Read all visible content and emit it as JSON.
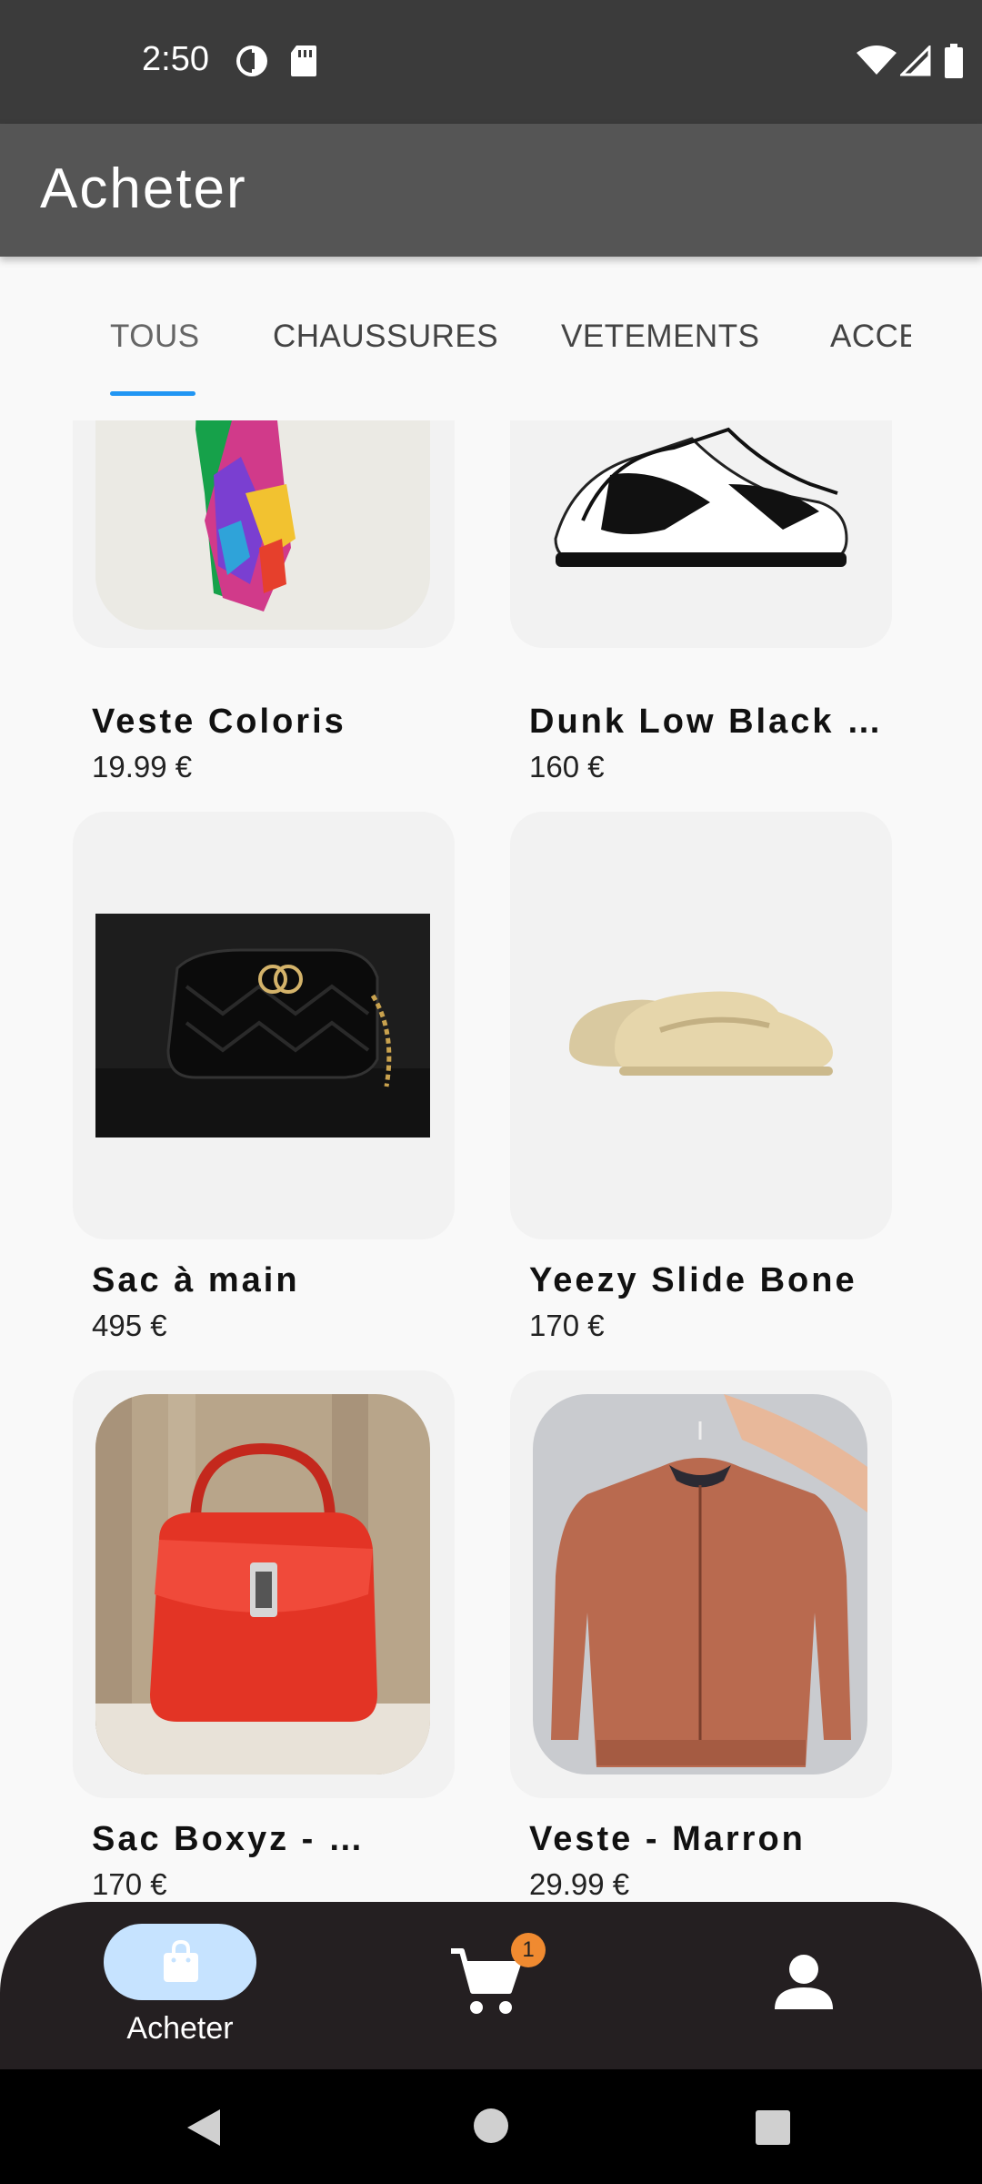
{
  "status_bar": {
    "time": "2:50",
    "icons": [
      "data-saver-icon",
      "sd-card-icon",
      "wifi-icon",
      "signal-icon",
      "battery-icon"
    ]
  },
  "app_bar": {
    "title": "Acheter"
  },
  "tabs": [
    {
      "label": "TOUS",
      "active": true
    },
    {
      "label": "CHAUSSURES",
      "active": false
    },
    {
      "label": "VETEMENTS",
      "active": false
    },
    {
      "label": "ACCE",
      "active": false
    }
  ],
  "products": [
    {
      "name": "Veste Coloris",
      "price": "19.99 €",
      "image": "scarf-photo"
    },
    {
      "name": "Dunk Low Black …",
      "price": "160 €",
      "image": "sneaker-photo"
    },
    {
      "name": "Sac à main",
      "price": "495 €",
      "image": "black-handbag-photo"
    },
    {
      "name": "Yeezy Slide Bone",
      "price": "170 €",
      "image": "slide-sandal-photo"
    },
    {
      "name": "Sac Boxyz - …",
      "price": "170 €",
      "image": "red-handbag-photo"
    },
    {
      "name": "Veste - Marron",
      "price": "29.99 €",
      "image": "brown-jacket-photo"
    }
  ],
  "bottom_nav": {
    "items": [
      {
        "label": "Acheter",
        "icon": "shopping-bag-icon",
        "active": true
      },
      {
        "label": "",
        "icon": "cart-icon",
        "badge": "1"
      },
      {
        "label": "",
        "icon": "profile-icon"
      }
    ]
  },
  "system_nav": [
    "back-icon",
    "home-icon",
    "recents-icon"
  ],
  "colors": {
    "status_bar": "#3b3b3b",
    "app_bar": "#555555",
    "tab_indicator": "#2196f3",
    "bottom_nav": "#241f21",
    "active_pill": "#c6e3ff",
    "badge": "#f08a30"
  }
}
